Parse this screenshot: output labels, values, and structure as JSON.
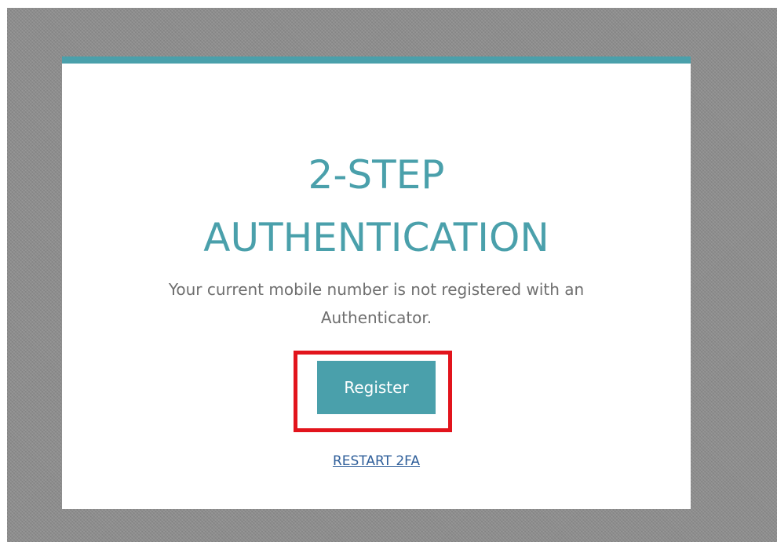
{
  "dialog": {
    "title_line1": "2-STEP",
    "title_line2": "AUTHENTICATION",
    "message_line1": "Your current mobile number is not registered with an",
    "message_line2": "Authenticator.",
    "register_label": "Register",
    "restart_label": "RESTART 2FA"
  },
  "colors": {
    "accent": "#4aa0ab",
    "highlight": "#e2141c",
    "link": "#2f5f9a",
    "background": "#8f8f8f"
  }
}
